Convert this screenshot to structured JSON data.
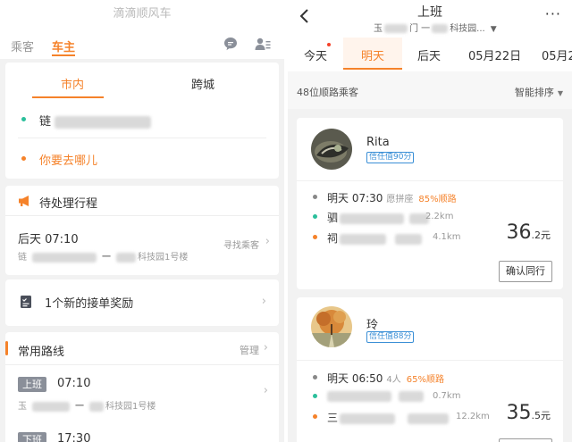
{
  "left": {
    "app_title": "滴滴顺风车",
    "role_tabs": {
      "passenger": "乘客",
      "driver": "车主"
    },
    "route_card": {
      "tab_local": "市内",
      "tab_intercity": "跨城",
      "from_prefix": "链",
      "to_placeholder": "你要去哪儿"
    },
    "pending": {
      "title": "待处理行程",
      "time": "后天 07:10",
      "from_prefix": "链",
      "arrow": "一",
      "to_suffix": "科技园1号楼",
      "action": "寻找乘客"
    },
    "reward": {
      "text": "1个新的接单奖励"
    },
    "common_routes": {
      "title": "常用路线",
      "manage": "管理",
      "routes": [
        {
          "tag": "上班",
          "time": "07:10",
          "from_prefix": "玉",
          "arrow": "一",
          "to_suffix": "科技园1号楼"
        },
        {
          "tag": "下班",
          "time": "17:30"
        }
      ]
    }
  },
  "right": {
    "page_title": "上班",
    "subtitle_from": "玉",
    "subtitle_mid": "门 一",
    "subtitle_to": "科技园...",
    "days": [
      "今天",
      "明天",
      "后天",
      "05月22日",
      "05月2"
    ],
    "active_day_index": 1,
    "passenger_count": "48位顺路乘客",
    "sort_label": "智能排序",
    "passengers": [
      {
        "name": "Rita",
        "trust": "信任值90分",
        "time": "明天 07:30",
        "seat": "愿拼座",
        "match": "85%顺路",
        "from_prefix": "驷",
        "from_dist": "2.2km",
        "to_prefix": "祠",
        "to_dist": "4.1km",
        "price_int": "36",
        "price_dec": ".2元",
        "confirm": "确认同行"
      },
      {
        "name": "玲",
        "trust": "信任值88分",
        "time": "明天 06:50",
        "seat": "4人",
        "match": "65%顺路",
        "from_prefix": "",
        "from_dist": "0.7km",
        "to_prefix": "三",
        "to_dist": "12.2km",
        "price_int": "35",
        "price_dec": ".5元"
      }
    ]
  },
  "colors": {
    "accent": "#f5822a",
    "green_dot": "#2bbf9b",
    "trust_blue": "#3a8fd6",
    "tag_gray": "#8a8f99"
  },
  "icons": [
    "chat-bubble-icon",
    "user-card-icon",
    "megaphone-icon",
    "checklist-icon",
    "back-arrow-icon",
    "more-icon",
    "chevron-right-icon",
    "caret-down-icon"
  ]
}
